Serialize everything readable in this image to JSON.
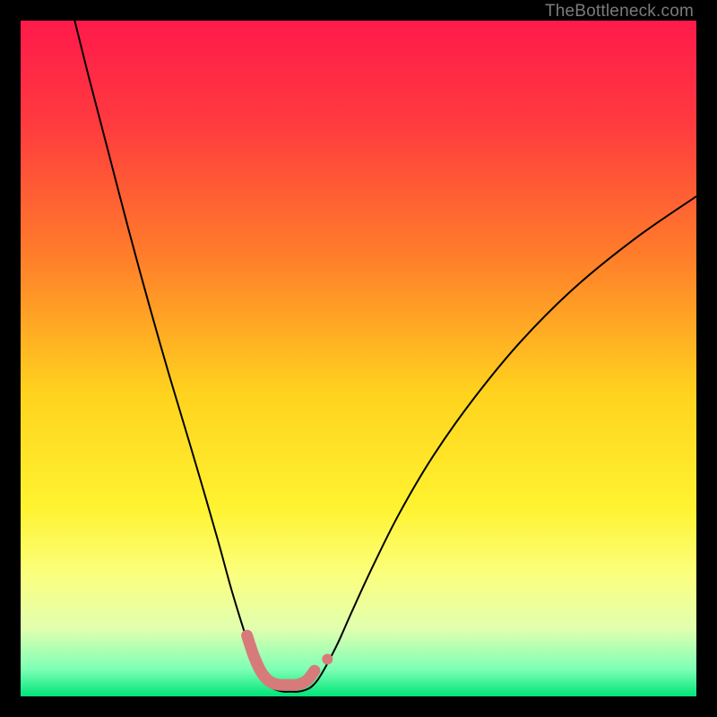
{
  "watermark": "TheBottleneck.com",
  "chart_data": {
    "type": "line",
    "title": "",
    "xlabel": "",
    "ylabel": "",
    "xlim": [
      0,
      100
    ],
    "ylim": [
      0,
      100
    ],
    "gradient_stops": [
      {
        "offset": 0.0,
        "color": "#ff1a4b"
      },
      {
        "offset": 0.15,
        "color": "#ff3a3f"
      },
      {
        "offset": 0.35,
        "color": "#ff7e2a"
      },
      {
        "offset": 0.55,
        "color": "#ffd21e"
      },
      {
        "offset": 0.72,
        "color": "#fff330"
      },
      {
        "offset": 0.82,
        "color": "#fbff7e"
      },
      {
        "offset": 0.9,
        "color": "#e1ffb0"
      },
      {
        "offset": 0.96,
        "color": "#7dffb5"
      },
      {
        "offset": 1.0,
        "color": "#00e579"
      }
    ],
    "series": [
      {
        "name": "bottleneck-curve",
        "color": "#000000",
        "width": 2,
        "points": [
          [
            8.0,
            100.0
          ],
          [
            10.0,
            92.0
          ],
          [
            13.0,
            80.5
          ],
          [
            16.0,
            69.0
          ],
          [
            19.0,
            58.0
          ],
          [
            22.0,
            47.5
          ],
          [
            25.0,
            37.5
          ],
          [
            27.5,
            29.0
          ],
          [
            29.5,
            22.0
          ],
          [
            31.0,
            16.5
          ],
          [
            32.5,
            11.5
          ],
          [
            33.8,
            7.5
          ],
          [
            35.0,
            4.5
          ],
          [
            36.0,
            2.5
          ],
          [
            37.0,
            1.4
          ],
          [
            38.0,
            0.9
          ],
          [
            39.0,
            0.7
          ],
          [
            40.0,
            0.7
          ],
          [
            41.0,
            0.7
          ],
          [
            42.0,
            0.9
          ],
          [
            43.0,
            1.4
          ],
          [
            44.0,
            2.5
          ],
          [
            45.2,
            4.5
          ],
          [
            47.0,
            8.0
          ],
          [
            49.0,
            12.5
          ],
          [
            52.0,
            19.0
          ],
          [
            56.0,
            27.0
          ],
          [
            61.0,
            35.5
          ],
          [
            67.0,
            44.0
          ],
          [
            74.0,
            52.5
          ],
          [
            82.0,
            60.5
          ],
          [
            91.0,
            67.8
          ],
          [
            100.0,
            74.0
          ]
        ]
      },
      {
        "name": "valley-marker",
        "color": "#d77a7a",
        "width": 13,
        "linecap": "round",
        "points": [
          [
            33.5,
            9.0
          ],
          [
            34.5,
            6.0
          ],
          [
            35.5,
            3.8
          ],
          [
            36.5,
            2.5
          ],
          [
            37.5,
            1.9
          ],
          [
            38.5,
            1.7
          ],
          [
            39.5,
            1.7
          ],
          [
            40.5,
            1.7
          ],
          [
            41.5,
            1.9
          ],
          [
            42.5,
            2.5
          ],
          [
            43.5,
            3.8
          ]
        ]
      }
    ],
    "markers": [
      {
        "name": "valley-dot",
        "x": 45.4,
        "y": 5.5,
        "r": 6,
        "color": "#d77a7a"
      }
    ]
  }
}
